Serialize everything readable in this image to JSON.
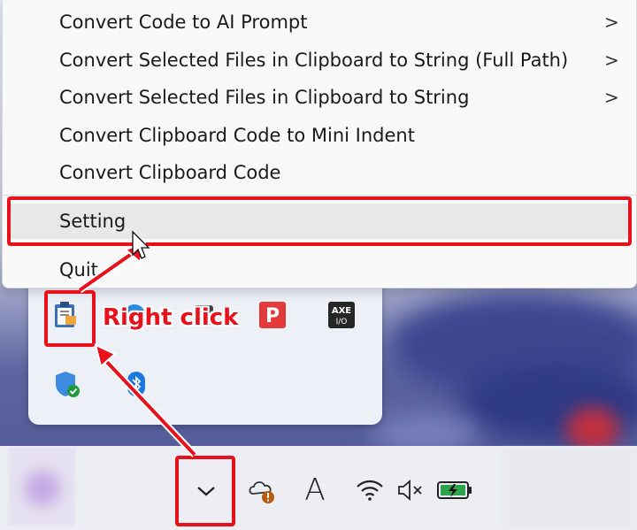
{
  "context_menu": {
    "items": [
      {
        "label": "Convert Code to AI Prompt",
        "submenu": true
      },
      {
        "label": "Convert Selected Files in Clipboard to String (Full Path)",
        "submenu": true
      },
      {
        "label": "Convert Selected Files in Clipboard to String",
        "submenu": true
      },
      {
        "label": "Convert Clipboard Code to Mini Indent",
        "submenu": false
      },
      {
        "label": "Convert Clipboard Code",
        "submenu": false
      },
      {
        "label": "Setting",
        "submenu": false,
        "highlighted": true
      },
      {
        "label": "Quit",
        "submenu": false
      }
    ],
    "submenu_glyph": ">"
  },
  "tray_flyout": {
    "icons": [
      "clipboard-app-icon",
      "edge-icon",
      "media-icon",
      "p-app-icon",
      "axe-io-icon",
      "windows-security-icon",
      "bluetooth-icon"
    ],
    "axe_label_top": "AXE",
    "axe_label_bottom": "I/O",
    "p_letter": "P"
  },
  "taskbar": {
    "icons": [
      "show-hidden-icons-chevron-icon",
      "onedrive-warning-icon",
      "ime-icon",
      "wifi-icon",
      "volume-muted-icon",
      "battery-charging-icon"
    ],
    "ime_glyph": "A"
  },
  "annotation": {
    "label": "Right click",
    "color": "#e8101a"
  }
}
